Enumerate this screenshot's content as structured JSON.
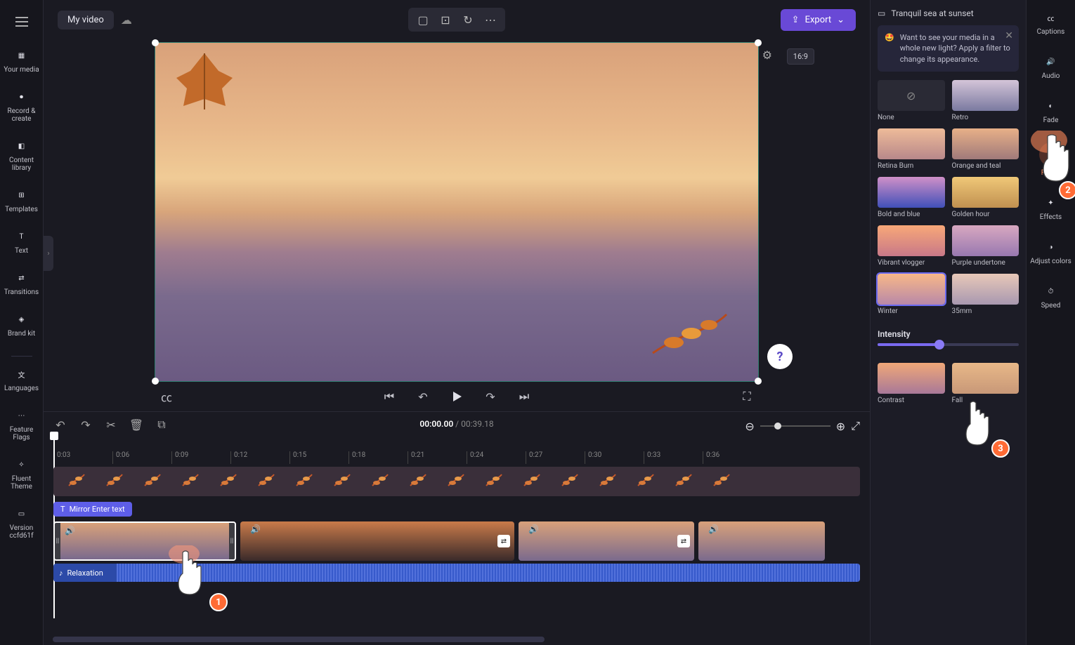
{
  "header": {
    "title": "My video",
    "export_label": "Export",
    "aspect_ratio": "16:9"
  },
  "left_nav": {
    "items": [
      {
        "label": "Your media"
      },
      {
        "label": "Record & create"
      },
      {
        "label": "Content library"
      },
      {
        "label": "Templates"
      },
      {
        "label": "Text"
      },
      {
        "label": "Transitions"
      },
      {
        "label": "Brand kit"
      }
    ],
    "tools": [
      {
        "label": "Languages"
      },
      {
        "label": "Feature Flags"
      },
      {
        "label": "Fluent Theme"
      },
      {
        "label": "Version ccfd61f"
      }
    ]
  },
  "playback": {
    "current": "00:00.00",
    "total": "00:39.18"
  },
  "timeline": {
    "ticks": [
      "0:03",
      "0:06",
      "0:09",
      "0:12",
      "0:15",
      "0:18",
      "0:21",
      "0:24",
      "0:27",
      "0:30",
      "0:33",
      "0:36"
    ],
    "text_clip_label": "Mirror Enter text",
    "audio_clip_label": "Relaxation"
  },
  "right_panel": {
    "media_title": "Tranquil sea at sunset",
    "tip_text": "Want to see your media in a whole new light? Apply a filter to change its appearance.",
    "intensity_label": "Intensity",
    "filters": [
      {
        "label": "None",
        "bg": "#2a2a35",
        "none": true
      },
      {
        "label": "Retro",
        "bg": "linear-gradient(to bottom,#d4c4d8,#7a7aa0)"
      },
      {
        "label": "Retina Burn",
        "bg": "linear-gradient(to bottom,#eebb99,#b8888a)"
      },
      {
        "label": "Orange and teal",
        "bg": "linear-gradient(to bottom,#e8b088,#a07a7a)"
      },
      {
        "label": "Bold and blue",
        "bg": "linear-gradient(to bottom,#d090c8,#4050b8)"
      },
      {
        "label": "Golden hour",
        "bg": "linear-gradient(to bottom,#f0c878,#c09050)"
      },
      {
        "label": "Vibrant vlogger",
        "bg": "linear-gradient(to bottom,#f8a878,#c87888)"
      },
      {
        "label": "Purple undertone",
        "bg": "linear-gradient(to bottom,#d8a8c0,#9878b0)"
      },
      {
        "label": "Winter",
        "bg": "linear-gradient(to bottom,#f8b888,#b888a8)",
        "selected": true
      },
      {
        "label": "35mm",
        "bg": "linear-gradient(to bottom,#e8c8b8,#a898b0)"
      },
      {
        "label": "Contrast",
        "bg": "linear-gradient(to bottom,#f0a878,#a87898)"
      },
      {
        "label": "Fall",
        "bg": "linear-gradient(to bottom,#e8b888,#c89878)"
      }
    ]
  },
  "right_rail": [
    {
      "label": "Captions"
    },
    {
      "label": "Audio"
    },
    {
      "label": "Fade"
    },
    {
      "label": "Filters",
      "active": true
    },
    {
      "label": "Effects"
    },
    {
      "label": "Adjust colors"
    },
    {
      "label": "Speed"
    }
  ],
  "annotations": {
    "step1": "1",
    "step2": "2",
    "step3": "3"
  }
}
